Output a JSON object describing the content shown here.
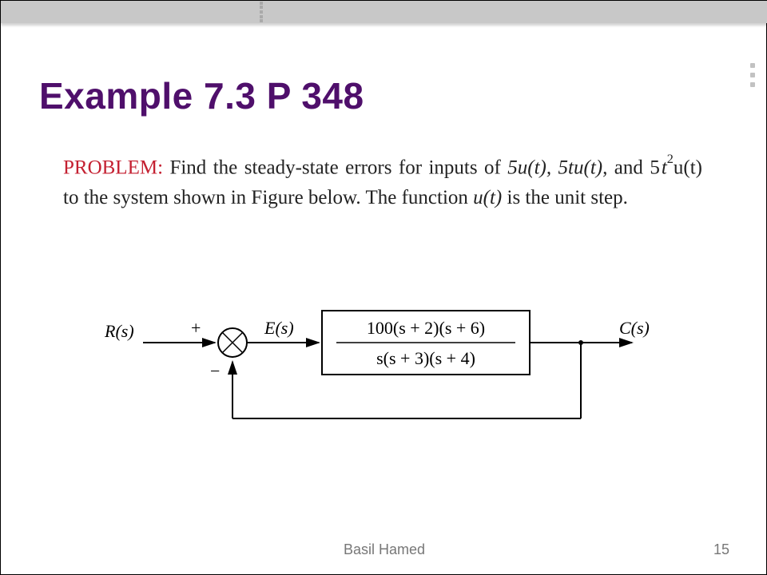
{
  "title": "Example 7.3 P 348",
  "body": {
    "problem_label": "PROBLEM:",
    "text_1": " Find the steady-state errors for inputs of ",
    "input_1": "5u(t),",
    "input_2": " 5tu(t),",
    "text_mid": " and ",
    "input_3a": "5",
    "input_3b": "t",
    "input_3exp": "2",
    "input_3c": "u(t)",
    "text_2": " to the system shown in Figure below. The function ",
    "ut": "u(t)",
    "text_3": " is the unit step."
  },
  "diagram": {
    "R": "R(s)",
    "E": "E(s)",
    "C": "C(s)",
    "plus": "+",
    "minus": "−",
    "tf_num": "100(s + 2)(s + 6)",
    "tf_den": "s(s + 3)(s + 4)"
  },
  "footer": {
    "author": "Basil Hamed",
    "page": "15"
  }
}
